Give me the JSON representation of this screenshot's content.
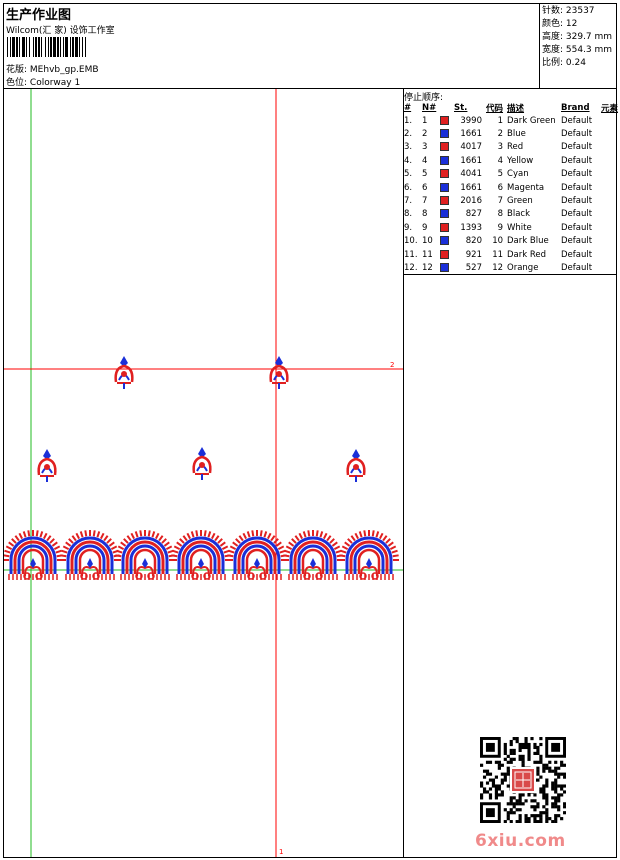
{
  "header": {
    "title": "生产作业图",
    "software": "Wilcom(汇 家) 设饰工作室",
    "pattern_label": "花版:",
    "pattern_value": "MEhvb_gp.EMB",
    "colorway_label": "色位:",
    "colorway_value": "Colorway 1"
  },
  "stats": {
    "stitches": "针数: 23537",
    "colors": "颜色: 12",
    "height": "高度: 329.7 mm",
    "width": "宽度: 554.3 mm",
    "scale": "比例: 0.24"
  },
  "canvas": {
    "marker_h": "2",
    "marker_v": "1"
  },
  "stop_sequence": {
    "title": "停止顺序:",
    "headers": [
      "#",
      "N#",
      "St.",
      "代码",
      "描述",
      "Brand",
      "元素"
    ],
    "rows": [
      {
        "idx": "1.",
        "n": "1",
        "color": "#e02020",
        "st": "3990",
        "code": "1",
        "desc": "Dark Green",
        "brand": "Default"
      },
      {
        "idx": "2.",
        "n": "2",
        "color": "#1a2fd8",
        "st": "1661",
        "code": "2",
        "desc": "Blue",
        "brand": "Default"
      },
      {
        "idx": "3.",
        "n": "3",
        "color": "#e02020",
        "st": "4017",
        "code": "3",
        "desc": "Red",
        "brand": "Default"
      },
      {
        "idx": "4.",
        "n": "4",
        "color": "#1a2fd8",
        "st": "1661",
        "code": "4",
        "desc": "Yellow",
        "brand": "Default"
      },
      {
        "idx": "5.",
        "n": "5",
        "color": "#e02020",
        "st": "4041",
        "code": "5",
        "desc": "Cyan",
        "brand": "Default"
      },
      {
        "idx": "6.",
        "n": "6",
        "color": "#1a2fd8",
        "st": "1661",
        "code": "6",
        "desc": "Magenta",
        "brand": "Default"
      },
      {
        "idx": "7.",
        "n": "7",
        "color": "#e02020",
        "st": "2016",
        "code": "7",
        "desc": "Green",
        "brand": "Default"
      },
      {
        "idx": "8.",
        "n": "8",
        "color": "#1a2fd8",
        "st": "827",
        "code": "8",
        "desc": "Black",
        "brand": "Default"
      },
      {
        "idx": "9.",
        "n": "9",
        "color": "#e02020",
        "st": "1393",
        "code": "9",
        "desc": "White",
        "brand": "Default"
      },
      {
        "idx": "10.",
        "n": "10",
        "color": "#1a2fd8",
        "st": "820",
        "code": "10",
        "desc": "Dark Blue",
        "brand": "Default"
      },
      {
        "idx": "11.",
        "n": "11",
        "color": "#e02020",
        "st": "921",
        "code": "11",
        "desc": "Dark Red",
        "brand": "Default"
      },
      {
        "idx": "12.",
        "n": "12",
        "color": "#1a2fd8",
        "st": "527",
        "code": "12",
        "desc": "Orange",
        "brand": "Default"
      }
    ]
  },
  "watermark": "6xiu.com",
  "colors": {
    "red": "#e02020",
    "blue": "#1a2fd8",
    "guide_red": "#ff0000",
    "guide_green": "#22bb22"
  }
}
